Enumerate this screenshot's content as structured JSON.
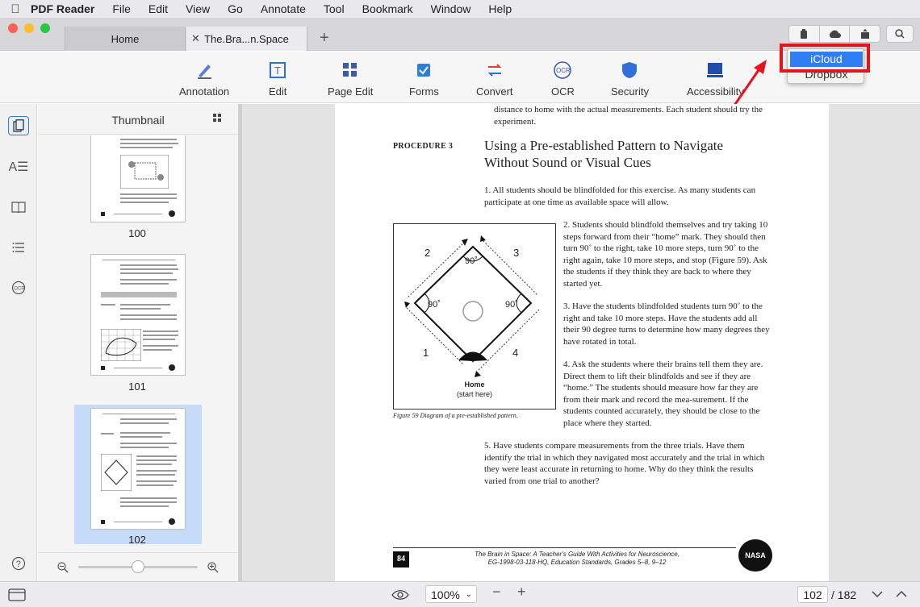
{
  "menubar": {
    "app_name": "PDF Reader",
    "items": [
      "File",
      "Edit",
      "View",
      "Go",
      "Annotate",
      "Tool",
      "Bookmark",
      "Window",
      "Help"
    ]
  },
  "tabs": [
    {
      "label": "Home"
    },
    {
      "label": "The.Bra...n.Space"
    }
  ],
  "toolbar": [
    {
      "label": "Annotation",
      "icon": "pen-icon"
    },
    {
      "label": "Edit",
      "icon": "edit-text-icon"
    },
    {
      "label": "Page Edit",
      "icon": "grid-icon"
    },
    {
      "label": "Forms",
      "icon": "checkbox-icon"
    },
    {
      "label": "Convert",
      "icon": "convert-icon"
    },
    {
      "label": "OCR",
      "icon": "ocr-icon"
    },
    {
      "label": "Security",
      "icon": "shield-icon"
    },
    {
      "label": "Accessibility",
      "icon": "accessibility-icon"
    }
  ],
  "cloud_dropdown": {
    "items": [
      "iCloud",
      "Dropbox"
    ],
    "selected": "iCloud"
  },
  "thumbnail_panel": {
    "title": "Thumbnail",
    "pages": [
      "100",
      "101",
      "102"
    ],
    "selected_page": "102"
  },
  "document": {
    "top_text": "distance to home with the actual measurements. Each student should try the experiment.",
    "procedure_label": "PROCEDURE 3",
    "procedure_title": "Using a Pre-established Pattern to Navigate Without Sound or Visual Cues",
    "step1": "1. All students should be blindfolded for this exercise. As many students can participate at one time as available space will allow.",
    "step2": "2. Students should blindfold themselves and try taking 10 steps forward from their “home” mark. They should then turn 90˚ to the right, take 10 more steps, turn 90˚ to the right again, take 10 more steps, and stop (Figure 59). Ask the students if they think they are back to where they started yet.",
    "step3": "3. Have the students blindfolded students turn 90˚ to the right and take 10 more steps. Have the students add all their 90 degree turns to determine how many degrees they have rotated in total.",
    "step4": "4. Ask the students where their brains tell them they are. Direct them to lift their blindfolds and see if they are “home.” The students should measure how far they are from their mark and record the mea-surement. If the students counted accurately, they should be close to the place where they started.",
    "step5": "5. Have students compare measurements from the three trials. Have them identify the trial in which they navigated most accurately and the trial in which they were least accurate in returning to home. Why do they think the results varied from one trial to another?",
    "figure": {
      "labels": [
        "2",
        "3",
        "1",
        "4"
      ],
      "angles": [
        "90˚",
        "90˚",
        "90˚"
      ],
      "home": "Home",
      "start": "(start here)",
      "caption": "Figure 59 Diagram of a pre-established pattern."
    },
    "page_label": "84",
    "footer_line1": "The Brain in Space: A Teacher's Guide With Activities for Neuroscience,",
    "footer_line2": "EG-1998-03-118-HQ, Education Standards, Grades 5–8, 9–12",
    "nasa": "NASA"
  },
  "bottombar": {
    "zoom": "100%",
    "current_page": "102",
    "total_pages": "/ 182"
  }
}
